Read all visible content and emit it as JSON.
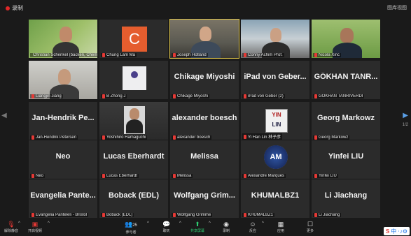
{
  "meeting": {
    "recording_label": "录制",
    "view_label": "图库视图"
  },
  "participants": [
    {
      "display": "",
      "label": "Christian Schenkel (backen, Chemnitz)",
      "video": "green"
    },
    {
      "display": "C",
      "label": "Chung Lam Ma",
      "video": "avatar"
    },
    {
      "display": "",
      "label": "Joseph Hotland",
      "video": "office",
      "active": true
    },
    {
      "display": "",
      "label": "Conny Achim Prof.",
      "video": "city"
    },
    {
      "display": "",
      "label": "Nicola Xinc",
      "video": "green2"
    },
    {
      "display": "",
      "label": "Liangjin Jiang",
      "video": "room"
    },
    {
      "display": "",
      "label": "B Zhong J",
      "video": "logo"
    },
    {
      "display": "Chikage Miyoshi",
      "label": "Chikage Miyoshi",
      "video": "none"
    },
    {
      "display": "iPad von Geber...",
      "label": "iPad von Geber (2)",
      "video": "none"
    },
    {
      "display": "GÖKHAN TANR...",
      "label": "GÖKHAN TANRIVERDI",
      "video": "none"
    },
    {
      "display": "Jan-Hendrik Pe...",
      "label": "Jan-Hendrik Petersen",
      "video": "none"
    },
    {
      "display": "",
      "label": "Yoshihiro Hamaguchi",
      "video": "person-dark"
    },
    {
      "display": "alexander boesch",
      "label": "alexander boesch",
      "video": "none"
    },
    {
      "display": "",
      "label": "Yi Han Lin 林子彦",
      "video": "yinlin"
    },
    {
      "display": "Georg Markowz",
      "label": "Georg Markowz",
      "video": "none"
    },
    {
      "display": "Neo",
      "label": "Neo",
      "video": "none"
    },
    {
      "display": "Lucas Eberhardt",
      "label": "Lucas Eberhardt",
      "video": "none"
    },
    {
      "display": "Melissa",
      "label": "Melissa",
      "video": "none"
    },
    {
      "display": "",
      "label": "Alexandre Marques",
      "video": "am"
    },
    {
      "display": "Yinfei LIU",
      "label": "Yinfei LIU",
      "video": "none"
    },
    {
      "display": "Evangelia Pante...",
      "label": "Evangelia Panteleli - Bristol",
      "video": "none"
    },
    {
      "display": "Boback (EDL)",
      "label": "Boback (EDL)",
      "video": "none"
    },
    {
      "display": "Wolfgang Grim...",
      "label": "Wolfgang Grimme",
      "video": "none"
    },
    {
      "display": "KHUMALBZ1",
      "label": "KHUMALBZ1",
      "video": "none"
    },
    {
      "display": "Li Jiachang",
      "label": "Li Jiachang",
      "video": "none"
    }
  ],
  "logos": {
    "yinlin_top": "YIN",
    "yinlin_bottom": "LIN",
    "am": "AM"
  },
  "pagination": {
    "right_page": "1/2",
    "left_page": "1/2"
  },
  "toolbar": {
    "unmute": "解除静音",
    "start_video": "开启视频",
    "participants": "参与者",
    "participants_count": "25",
    "chat": "聊天",
    "share": "共享屏幕",
    "record": "录制",
    "reactions": "反应",
    "apps": "应用",
    "more": "更多"
  },
  "ime": {
    "label": "中",
    "brand": "S"
  }
}
